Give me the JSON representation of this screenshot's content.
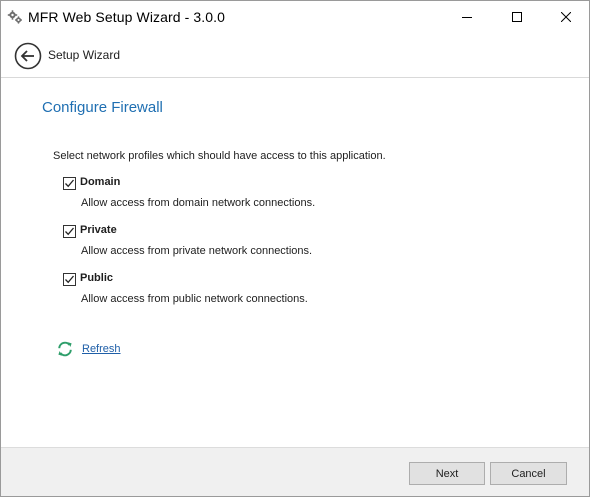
{
  "window": {
    "title": "MFR Web Setup Wizard - 3.0.0"
  },
  "header": {
    "back_icon": "back-arrow-icon",
    "title": "Setup Wizard"
  },
  "page": {
    "title": "Configure Firewall",
    "intro": "Select network profiles which should have access to this application.",
    "options": [
      {
        "label": "Domain",
        "checked": true,
        "description": "Allow access from domain network connections."
      },
      {
        "label": "Private",
        "checked": true,
        "description": "Allow access from private network connections."
      },
      {
        "label": "Public",
        "checked": true,
        "description": "Allow access from public network connections."
      }
    ],
    "refresh_label": "Refresh"
  },
  "footer": {
    "next_label": "Next",
    "cancel_label": "Cancel"
  },
  "colors": {
    "accent": "#1f6fb2",
    "link": "#1f5fa8",
    "refresh_icon": "#2e9e6a"
  }
}
